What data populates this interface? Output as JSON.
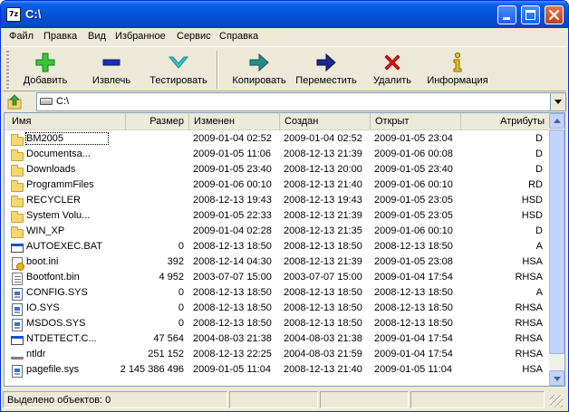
{
  "window": {
    "title": "C:\\",
    "app_icon_text": "7z"
  },
  "menu": [
    "Файл",
    "Правка",
    "Вид",
    "Избранное",
    "Сервис",
    "Справка"
  ],
  "toolbar": {
    "add_label": "Добавить",
    "extract_label": "Извлечь",
    "test_label": "Тестировать",
    "copy_label": "Копировать",
    "move_label": "Переместить",
    "delete_label": "Удалить",
    "info_label": "Информация"
  },
  "address": {
    "path": "C:\\"
  },
  "columns": {
    "name": "Имя",
    "size": "Размер",
    "modified": "Изменен",
    "created": "Создан",
    "accessed": "Открыт",
    "attributes": "Атрибуты"
  },
  "files": [
    {
      "name": "BM2005",
      "size": "",
      "modified": "2009-01-04 02:52",
      "created": "2009-01-04 02:52",
      "accessed": "2009-01-05 23:04",
      "attr": "D",
      "icon": "folder-icon"
    },
    {
      "name": "Documentsa...",
      "size": "",
      "modified": "2009-01-05 11:06",
      "created": "2008-12-13 21:39",
      "accessed": "2009-01-06 00:08",
      "attr": "D",
      "icon": "folder-icon"
    },
    {
      "name": "Downloads",
      "size": "",
      "modified": "2009-01-05 23:40",
      "created": "2008-12-13 20:00",
      "accessed": "2009-01-05 23:40",
      "attr": "D",
      "icon": "folder-icon"
    },
    {
      "name": "ProgrammFiles",
      "size": "",
      "modified": "2009-01-06 00:10",
      "created": "2008-12-13 21:40",
      "accessed": "2009-01-06 00:10",
      "attr": "RD",
      "icon": "folder-icon"
    },
    {
      "name": "RECYCLER",
      "size": "",
      "modified": "2008-12-13 19:43",
      "created": "2008-12-13 19:43",
      "accessed": "2009-01-05 23:05",
      "attr": "HSD",
      "icon": "folder-icon"
    },
    {
      "name": "System Volu...",
      "size": "",
      "modified": "2009-01-05 22:33",
      "created": "2008-12-13 21:39",
      "accessed": "2009-01-05 23:05",
      "attr": "HSD",
      "icon": "folder-icon"
    },
    {
      "name": "WIN_XP",
      "size": "",
      "modified": "2009-01-04 02:28",
      "created": "2008-12-13 21:35",
      "accessed": "2009-01-06 00:10",
      "attr": "D",
      "icon": "folder-icon"
    },
    {
      "name": "AUTOEXEC.BAT",
      "size": "0",
      "modified": "2008-12-13 18:50",
      "created": "2008-12-13 18:50",
      "accessed": "2008-12-13 18:50",
      "attr": "A",
      "icon": "batch-file-icon"
    },
    {
      "name": "boot.ini",
      "size": "392",
      "modified": "2008-12-14 04:30",
      "created": "2008-12-13 21:39",
      "accessed": "2009-01-05 23:08",
      "attr": "HSA",
      "icon": "ini-file-icon"
    },
    {
      "name": "Bootfont.bin",
      "size": "4 952",
      "modified": "2003-07-07 15:00",
      "created": "2003-07-07 15:00",
      "accessed": "2009-01-04 17:54",
      "attr": "RHSA",
      "icon": "binary-file-icon"
    },
    {
      "name": "CONFIG.SYS",
      "size": "0",
      "modified": "2008-12-13 18:50",
      "created": "2008-12-13 18:50",
      "accessed": "2008-12-13 18:50",
      "attr": "A",
      "icon": "system-file-icon"
    },
    {
      "name": "IO.SYS",
      "size": "0",
      "modified": "2008-12-13 18:50",
      "created": "2008-12-13 18:50",
      "accessed": "2008-12-13 18:50",
      "attr": "RHSA",
      "icon": "system-file-icon"
    },
    {
      "name": "MSDOS.SYS",
      "size": "0",
      "modified": "2008-12-13 18:50",
      "created": "2008-12-13 18:50",
      "accessed": "2008-12-13 18:50",
      "attr": "RHSA",
      "icon": "system-file-icon"
    },
    {
      "name": "NTDETECT.C...",
      "size": "47 564",
      "modified": "2004-08-03 21:38",
      "created": "2004-08-03 21:38",
      "accessed": "2009-01-04 17:54",
      "attr": "RHSA",
      "icon": "executable-file-icon"
    },
    {
      "name": "ntldr",
      "size": "251 152",
      "modified": "2008-12-13 22:25",
      "created": "2004-08-03 21:59",
      "accessed": "2009-01-04 17:54",
      "attr": "RHSA",
      "icon": "loader-file-icon"
    },
    {
      "name": "pagefile.sys",
      "size": "2 145 386 496",
      "modified": "2009-01-05 11:04",
      "created": "2008-12-13 21:40",
      "accessed": "2009-01-05 11:04",
      "attr": "HSA",
      "icon": "system-file-icon"
    }
  ],
  "status": {
    "selected_text": "Выделено объектов: 0"
  },
  "colors": {
    "titlebar": "#0353d9",
    "add_icon": "#3ac43a",
    "extract_icon": "#1a2fb5",
    "test_icon": "#35c6c8",
    "copy_icon": "#2a8a8a",
    "move_icon": "#1a2a8a",
    "delete_icon": "#e01010",
    "info_icon": "#e0c020"
  }
}
